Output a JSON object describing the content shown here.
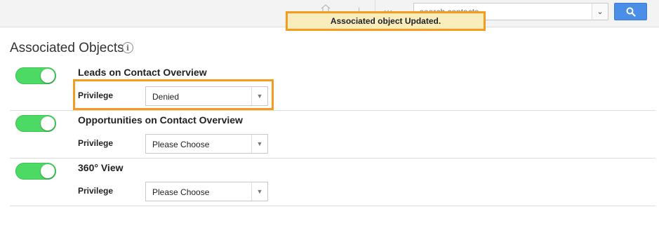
{
  "topbar": {
    "search_placeholder": "search contacts",
    "dots": "...",
    "caret_glyph": "⌄",
    "search_icon": "search-icon",
    "home_icon": "home-icon",
    "search_button_color": "#4a8ee8"
  },
  "toast": {
    "message": "Associated object Updated.",
    "background": "#f9edbe",
    "border": "#f39c1f"
  },
  "section": {
    "title": "Associated Objects",
    "info_glyph": "i"
  },
  "rows": [
    {
      "title": "Leads on Contact Overview",
      "privilege_label": "Privilege",
      "privilege_value": "Denied",
      "enabled": true
    },
    {
      "title": "Opportunities on Contact Overview",
      "privilege_label": "Privilege",
      "privilege_value": "Please Choose",
      "enabled": true
    },
    {
      "title": "360° View",
      "privilege_label": "Privilege",
      "privilege_value": "Please Choose",
      "enabled": true
    }
  ],
  "toggle_color": "#4cd964",
  "select_arrow_glyph": "▼"
}
